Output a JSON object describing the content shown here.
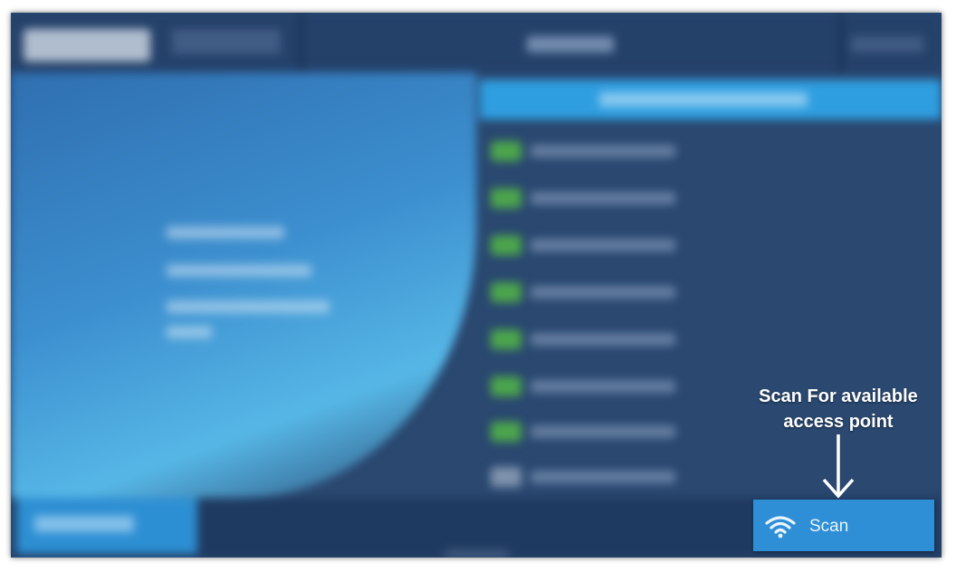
{
  "scan_button": {
    "label": "Scan",
    "icon": "wifi-icon"
  },
  "annotation": {
    "text_line1": "Scan For available",
    "text_line2": "access point",
    "arrow": "down-arrow-icon"
  },
  "colors": {
    "accent": "#2e8fd6",
    "list_header": "#2f9ee0",
    "background": "#2a4870",
    "signal": "#4ca64c"
  }
}
